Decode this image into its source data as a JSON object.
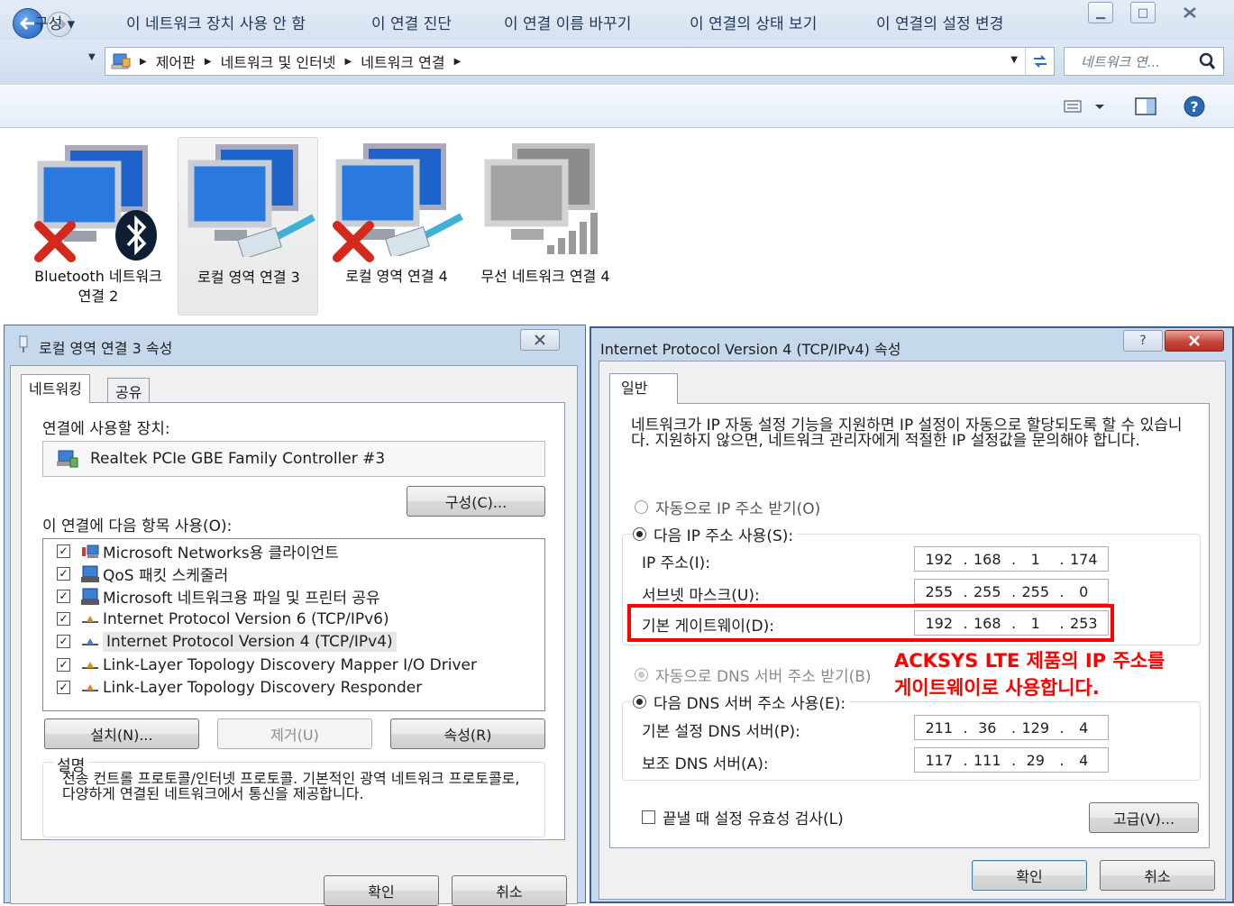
{
  "explorer": {
    "breadcrumbs": [
      "제어판",
      "네트워크 및 인터넷",
      "네트워크 연결"
    ],
    "search_placeholder": "네트워크 연...",
    "commands": [
      "구성 ▾",
      "이 네트워크 장치 사용 안 함",
      "이 연결 진단",
      "이 연결 이름 바꾸기",
      "이 연결의 상태 보기",
      "이 연결의 설정 변경"
    ],
    "connections": [
      {
        "label": "Bluetooth 네트워크 연결 2",
        "status_icon": "red-x-icon",
        "badge": "bluetooth-icon",
        "color": "blue"
      },
      {
        "label": "로컬 영역 연결 3",
        "status_icon": "none",
        "badge": "ethernet-cable-icon",
        "color": "blue",
        "selected": true
      },
      {
        "label": "로컬 영역 연결 4",
        "status_icon": "red-x-icon",
        "badge": "ethernet-cable-icon",
        "color": "blue"
      },
      {
        "label": "무선 네트워크 연결 4",
        "status_icon": "none",
        "badge": "signal-bars-icon",
        "color": "gray"
      }
    ]
  },
  "props_dialog": {
    "title": "로컬 영역 연결 3 속성",
    "tabs": [
      "네트워킹",
      "공유"
    ],
    "connect_using_label": "연결에 사용할 장치:",
    "adapter_name": "Realtek PCIe GBE Family Controller #3",
    "configure_button": "구성(C)...",
    "items_label": "이 연결에 다음 항목 사용(O):",
    "items": [
      {
        "label": "Microsoft Networks용 클라이언트",
        "checked": true,
        "icon": "network-client-icon"
      },
      {
        "label": "QoS 패킷 스케줄러",
        "checked": true,
        "icon": "service-icon"
      },
      {
        "label": "Microsoft 네트워크용 파일 및 프린터 공유",
        "checked": true,
        "icon": "service-icon"
      },
      {
        "label": "Internet Protocol Version 6 (TCP/IPv6)",
        "checked": true,
        "icon": "protocol-icon"
      },
      {
        "label": "Internet Protocol Version 4 (TCP/IPv4)",
        "checked": true,
        "icon": "protocol-icon",
        "selected": true
      },
      {
        "label": "Link-Layer Topology Discovery Mapper I/O Driver",
        "checked": true,
        "icon": "protocol-icon"
      },
      {
        "label": "Link-Layer Topology Discovery Responder",
        "checked": true,
        "icon": "protocol-icon"
      }
    ],
    "install_button": "설치(N)...",
    "uninstall_button": "제거(U)",
    "properties_button": "속성(R)",
    "description_title": "설명",
    "description_text": "전송 컨트롤 프로토콜/인터넷 프로토콜. 기본적인 광역 네트워크 프로토콜로, 다양하게 연결된 네트워크에서 통신을 제공합니다.",
    "ok_button": "확인",
    "cancel_button": "취소"
  },
  "ipv4_dialog": {
    "title": "Internet Protocol Version 4 (TCP/IPv4) 속성",
    "tab": "일반",
    "intro_text": "네트워크가 IP 자동 설정 기능을 지원하면 IP 설정이 자동으로 할당되도록 할 수 있습니다. 지원하지 않으면, 네트워크 관리자에게 적절한 IP 설정값을 문의해야 합니다.",
    "auto_ip_label": "자동으로 IP 주소 받기(O)",
    "manual_ip_label": "다음 IP 주소 사용(S):",
    "ip_label": "IP 주소(I):",
    "ip_value": [
      "192",
      "168",
      "1",
      "174"
    ],
    "subnet_label": "서브넷 마스크(U):",
    "subnet_value": [
      "255",
      "255",
      "255",
      "0"
    ],
    "gateway_label": "기본 게이트웨이(D):",
    "gateway_value": [
      "192",
      "168",
      "1",
      "253"
    ],
    "auto_dns_label": "자동으로 DNS 서버 주소 받기(B)",
    "manual_dns_label": "다음 DNS 서버 주소 사용(E):",
    "preferred_dns_label": "기본 설정 DNS 서버(P):",
    "preferred_dns_value": [
      "211",
      "36",
      "129",
      "4"
    ],
    "alternate_dns_label": "보조 DNS 서버(A):",
    "alternate_dns_value": [
      "117",
      "111",
      "29",
      "4"
    ],
    "validate_label": "끝낼 때 설정 유효성 검사(L)",
    "advanced_button": "고급(V)...",
    "ok_button": "확인",
    "cancel_button": "취소",
    "help_button": "?",
    "close_button": "X"
  },
  "annotation": {
    "text_line1": "ACKSYS LTE 제품의 IP 주소를",
    "text_line2": "게이트웨이로 사용합니다.",
    "color": "#ff0000"
  },
  "colors": {
    "highlight_box": "#ff0000",
    "dialog_frame": "#c6d8ec",
    "close_button_red": "#c9463d"
  }
}
